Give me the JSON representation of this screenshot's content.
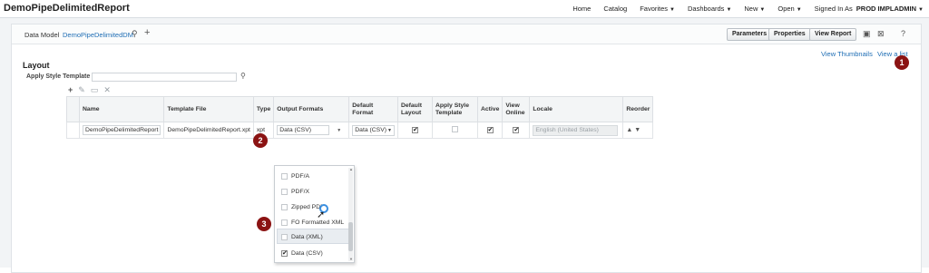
{
  "app": {
    "title": "DemoPipeDelimitedReport"
  },
  "topnav": {
    "home": "Home",
    "catalog": "Catalog",
    "favorites": "Favorites",
    "dashboards": "Dashboards",
    "new": "New",
    "open": "Open",
    "signed_in_as": "Signed In As",
    "user": "PROD IMPLADMIN"
  },
  "toolbar": {
    "data_model_label": "Data Model",
    "data_model_value": "DemoPipeDelimitedDM",
    "parameters": "Parameters",
    "properties": "Properties",
    "view_report": "View Report"
  },
  "view_links": {
    "thumbnails": "View Thumbnails",
    "list": "View a list"
  },
  "layout": {
    "heading": "Layout",
    "apply_style_template_label": "Apply Style Template",
    "apply_style_template_value": ""
  },
  "grid": {
    "headers": [
      "Name",
      "Template File",
      "Type",
      "Output Formats",
      "Default Format",
      "Default Layout",
      "Apply Style Template",
      "Active",
      "View Online",
      "Locale",
      "Reorder"
    ],
    "row": {
      "name": "DemoPipeDelimitedReport",
      "template_file": "DemoPipeDelimitedReport.xpt",
      "type": "xpt",
      "output_formats": "Data (CSV)",
      "default_format": "Data (CSV)",
      "default_layout": true,
      "apply_style_template": false,
      "active": true,
      "view_online": true,
      "locale": "English (United States)"
    }
  },
  "dropdown": {
    "items": [
      {
        "label": "PDF/A",
        "checked": false
      },
      {
        "label": "PDF/X",
        "checked": false
      },
      {
        "label": "Zipped PDFs",
        "checked": false
      },
      {
        "label": "FO Formatted XML",
        "checked": false
      },
      {
        "label": "Data (XML)",
        "checked": false
      },
      {
        "label": "Data (CSV)",
        "checked": true
      }
    ]
  },
  "callouts": [
    "1",
    "2",
    "3"
  ],
  "colors": {
    "link": "#1f6eb5",
    "callout": "#8b1313",
    "focus_ring": "#3b8fe0"
  }
}
